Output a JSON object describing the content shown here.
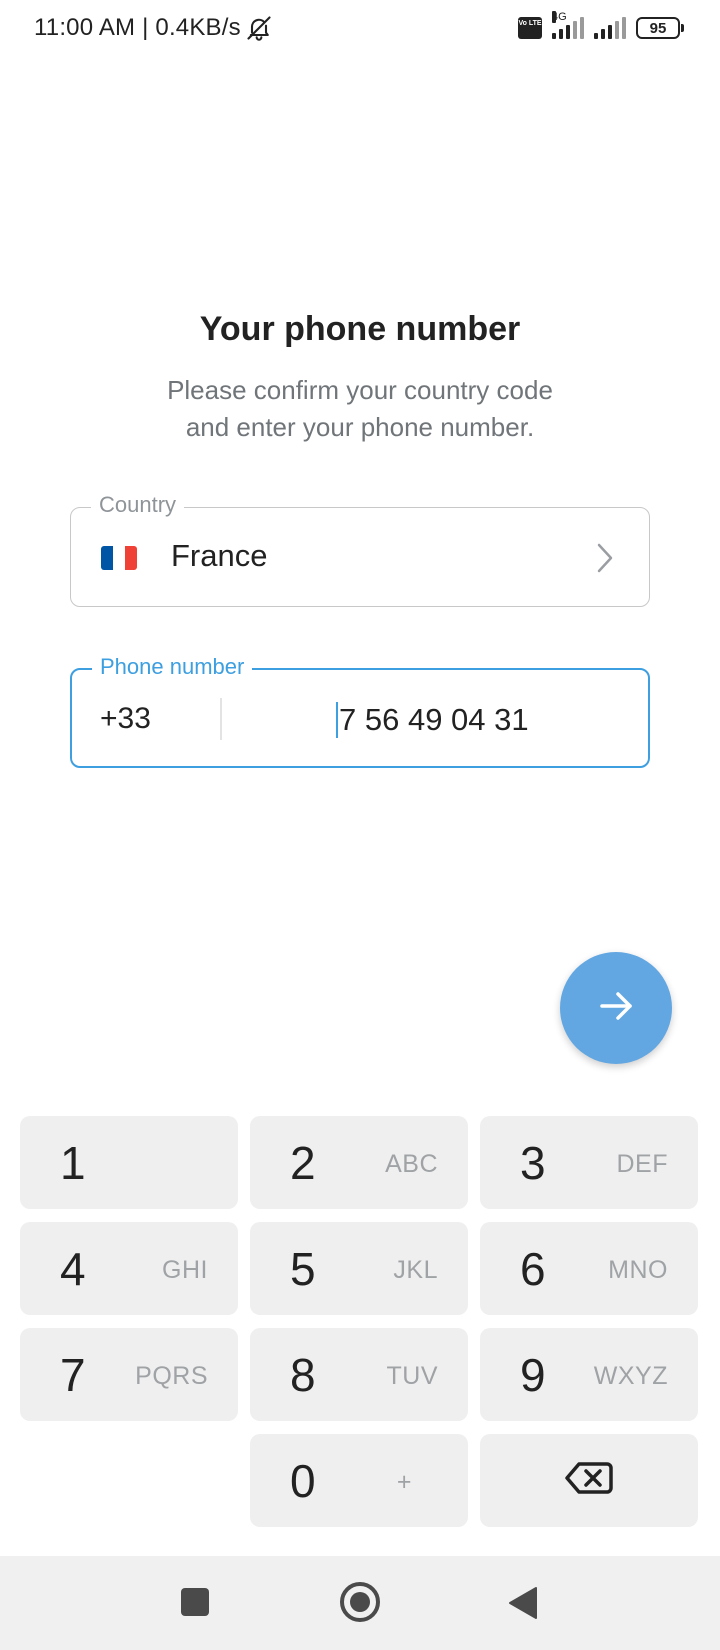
{
  "status_bar": {
    "time_speed": "11:00 AM | 0.4KB/s",
    "volte": "Vo LTE",
    "network": "4G",
    "battery": "95"
  },
  "header": {
    "title": "Your phone number",
    "subtitle_line1": "Please confirm your country code",
    "subtitle_line2": "and enter your phone number."
  },
  "country_field": {
    "label": "Country",
    "value": "France",
    "flag_colors": [
      "#0055A4",
      "#FFFFFF",
      "#EF4135"
    ]
  },
  "phone_field": {
    "label": "Phone number",
    "code": "+33",
    "number": "7 56 49 04 31"
  },
  "accent_color": "#3d9fe0",
  "fab_color": "#62a7e2",
  "keypad": {
    "keys": [
      {
        "digit": "1",
        "letters": ""
      },
      {
        "digit": "2",
        "letters": "ABC"
      },
      {
        "digit": "3",
        "letters": "DEF"
      },
      {
        "digit": "4",
        "letters": "GHI"
      },
      {
        "digit": "5",
        "letters": "JKL"
      },
      {
        "digit": "6",
        "letters": "MNO"
      },
      {
        "digit": "7",
        "letters": "PQRS"
      },
      {
        "digit": "8",
        "letters": "TUV"
      },
      {
        "digit": "9",
        "letters": "WXYZ"
      },
      {
        "digit": "0",
        "letters": "+"
      }
    ]
  }
}
